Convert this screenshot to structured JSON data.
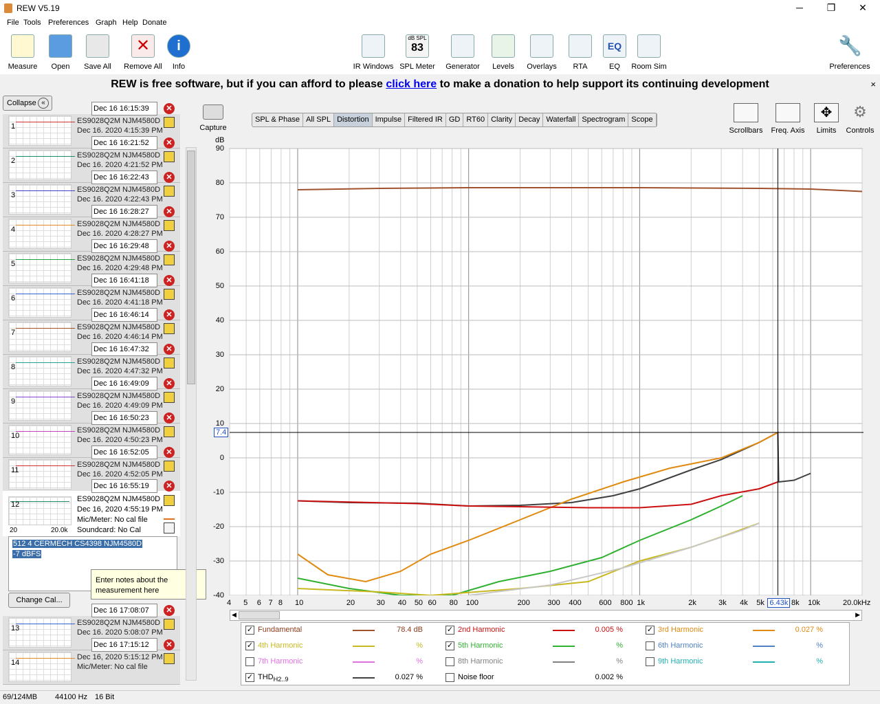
{
  "window": {
    "title": "REW V5.19"
  },
  "menu": [
    "File",
    "Tools",
    "Preferences",
    "Graph",
    "Help",
    "Donate"
  ],
  "toolbar": {
    "left": [
      {
        "label": "Measure",
        "icon": "measure-icon"
      },
      {
        "label": "Open",
        "icon": "folder-open-icon"
      },
      {
        "label": "Save All",
        "icon": "save-all-icon"
      },
      {
        "label": "Remove All",
        "icon": "remove-all-icon"
      },
      {
        "label": "Info",
        "icon": "info-icon"
      }
    ],
    "center": [
      {
        "label": "IR Windows",
        "icon": "ir-windows-icon"
      },
      {
        "label": "SPL Meter",
        "icon": "spl-meter-icon",
        "badge_top": "dB SPL",
        "badge_value": "83"
      },
      {
        "label": "Generator",
        "icon": "generator-icon"
      },
      {
        "label": "Levels",
        "icon": "levels-icon"
      },
      {
        "label": "Overlays",
        "icon": "overlays-icon"
      },
      {
        "label": "RTA",
        "icon": "rta-icon"
      },
      {
        "label": "EQ",
        "icon": "eq-icon"
      },
      {
        "label": "Room Sim",
        "icon": "room-sim-icon"
      }
    ],
    "right": {
      "label": "Preferences",
      "icon": "preferences-icon"
    }
  },
  "donation": {
    "prefix": "REW is free software, but if you can afford to please",
    "link": "click here",
    "suffix": "to make a donation to help support its continuing development",
    "close": "×"
  },
  "left_panel": {
    "collapse_label": "Collapse",
    "measurements": [
      {
        "num": "1",
        "stamp": "Dec 16 16:15:39",
        "name": "ES9028Q2M NJM4580D (",
        "date": "Dec 16, 2020 4:15:39 PM",
        "color": "#d03030"
      },
      {
        "num": "2",
        "stamp": "Dec 16 16:21:52",
        "name": "ES9028Q2M NJM4580D (",
        "date": "Dec 16, 2020 4:21:52 PM",
        "color": "#1a8a6a"
      },
      {
        "num": "3",
        "stamp": "Dec 16 16:22:43",
        "name": "ES9028Q2M NJM4580D (",
        "date": "Dec 16, 2020 4:22:43 PM",
        "color": "#4040d0"
      },
      {
        "num": "4",
        "stamp": "Dec 16 16:28:27",
        "name": "ES9028Q2M NJM4580D (",
        "date": "Dec 16, 2020 4:28:27 PM",
        "color": "#e08a20"
      },
      {
        "num": "5",
        "stamp": "Dec 16 16:29:48",
        "name": "ES9028Q2M NJM4580D (",
        "date": "Dec 16, 2020 4:29:48 PM",
        "color": "#20a040"
      },
      {
        "num": "6",
        "stamp": "Dec 16 16:41:18",
        "name": "ES9028Q2M NJM4580D (",
        "date": "Dec 16, 2020 4:41:18 PM",
        "color": "#3060d0"
      },
      {
        "num": "7",
        "stamp": "Dec 16 16:46:14",
        "name": "ES9028Q2M NJM4580D (",
        "date": "Dec 16, 2020 4:46:14 PM",
        "color": "#a05020"
      },
      {
        "num": "8",
        "stamp": "Dec 16 16:47:32",
        "name": "ES9028Q2M NJM4580D (",
        "date": "Dec 16, 2020 4:47:32 PM",
        "color": "#20a090"
      },
      {
        "num": "9",
        "stamp": "Dec 16 16:49:09",
        "name": "ES9028Q2M NJM4580D (",
        "date": "Dec 16, 2020 4:49:09 PM",
        "color": "#8040d0"
      },
      {
        "num": "10",
        "stamp": "Dec 16 16:50:23",
        "name": "ES9028Q2M NJM4580D (",
        "date": "Dec 16, 2020 4:50:23 PM",
        "color": "#c040c0"
      },
      {
        "num": "11",
        "stamp": "Dec 16 16:52:05",
        "name": "ES9028Q2M NJM4580D (",
        "date": "Dec 16, 2020 4:52:05 PM",
        "color": "#d03030"
      }
    ],
    "expanded": {
      "num": "12",
      "stamp": "Dec 16 16:55:19",
      "name": "ES9028Q2M NJM4580D (",
      "date": "Dec 16, 2020 4:55:19 PM",
      "mic": "Mic/Meter: No cal file",
      "soundcard": "Soundcard: No Cal",
      "thumb_left": "20",
      "thumb_right": "20.0k",
      "notes_line1": "512 4 CERMECH CS4398 NJM4580D",
      "notes_line2": "-7 dBFS",
      "tooltip": "Enter notes about the measurement here",
      "change_cal": "Change Cal..."
    },
    "after": [
      {
        "num": "13",
        "stamp": "Dec 16 17:08:07",
        "name": "ES9028Q2M NJM4580D (",
        "date": "Dec 16, 2020 5:08:07 PM",
        "color": "#3060d0"
      },
      {
        "num": "14",
        "stamp": "Dec 16 17:15:12",
        "name": "Dec 16, 2020 5:15:12 PM",
        "date": "Mic/Meter: No cal file",
        "color": "#e08a20"
      }
    ]
  },
  "capture": {
    "label": "Capture"
  },
  "tabs": [
    "SPL & Phase",
    "All SPL",
    "Distortion",
    "Impulse",
    "Filtered IR",
    "GD",
    "RT60",
    "Clarity",
    "Decay",
    "Waterfall",
    "Spectrogram",
    "Scope"
  ],
  "active_tab": "Distortion",
  "right_tools": [
    {
      "label": "Scrollbars",
      "icon": "scrollbars-icon"
    },
    {
      "label": "Freq. Axis",
      "icon": "freq-axis-icon"
    },
    {
      "label": "Limits",
      "icon": "limits-icon"
    },
    {
      "label": "Controls",
      "icon": "controls-icon"
    }
  ],
  "chart_data": {
    "type": "line",
    "ylabel": "dB",
    "ylim": [
      -40,
      90
    ],
    "yticks": [
      90,
      80,
      70,
      60,
      50,
      40,
      30,
      20,
      10,
      0,
      -10,
      -20,
      -30,
      -40
    ],
    "xscale": "log",
    "xlim": [
      4,
      20000
    ],
    "xticks": [
      {
        "v": 4,
        "l": "4"
      },
      {
        "v": 5,
        "l": "5"
      },
      {
        "v": 6,
        "l": "6"
      },
      {
        "v": 7,
        "l": "7"
      },
      {
        "v": 8,
        "l": "8"
      },
      {
        "v": 10,
        "l": "10"
      },
      {
        "v": 20,
        "l": "20"
      },
      {
        "v": 30,
        "l": "30"
      },
      {
        "v": 40,
        "l": "40"
      },
      {
        "v": 50,
        "l": "50"
      },
      {
        "v": 60,
        "l": "60"
      },
      {
        "v": 80,
        "l": "80"
      },
      {
        "v": 100,
        "l": "100"
      },
      {
        "v": 200,
        "l": "200"
      },
      {
        "v": 300,
        "l": "300"
      },
      {
        "v": 400,
        "l": "400"
      },
      {
        "v": 600,
        "l": "600"
      },
      {
        "v": 800,
        "l": "800"
      },
      {
        "v": 1000,
        "l": "1k"
      },
      {
        "v": 2000,
        "l": "2k"
      },
      {
        "v": 3000,
        "l": "3k"
      },
      {
        "v": 4000,
        "l": "4k"
      },
      {
        "v": 5000,
        "l": "5k"
      },
      {
        "v": 8000,
        "l": "8k"
      },
      {
        "v": 10000,
        "l": "10k"
      },
      {
        "v": 20000,
        "l": "20.0kHz"
      }
    ],
    "cursor": {
      "x": 6430,
      "x_label": "6.43k",
      "y": 7.4,
      "y_label": "7.4"
    },
    "series": [
      {
        "name": "Fundamental",
        "color": "#a0522d",
        "points": [
          [
            10,
            78
          ],
          [
            30,
            78.4
          ],
          [
            100,
            78.6
          ],
          [
            1000,
            78.6
          ],
          [
            5000,
            78.4
          ],
          [
            10000,
            78.2
          ],
          [
            15000,
            77.8
          ],
          [
            20000,
            77.5
          ]
        ]
      },
      {
        "name": "THD",
        "color": "#404040",
        "points": [
          [
            10,
            -12.5
          ],
          [
            20,
            -13
          ],
          [
            50,
            -13.2
          ],
          [
            100,
            -14
          ],
          [
            200,
            -13.8
          ],
          [
            400,
            -13
          ],
          [
            700,
            -11
          ],
          [
            1000,
            -9
          ],
          [
            2000,
            -3.5
          ],
          [
            3000,
            -0.5
          ],
          [
            5000,
            4.5
          ],
          [
            6430,
            7.4
          ],
          [
            6500,
            -7
          ],
          [
            8000,
            -6.5
          ],
          [
            10000,
            -4.5
          ]
        ]
      },
      {
        "name": "3rd Harmonic",
        "color": "#e08a10",
        "points": [
          [
            10,
            -28
          ],
          [
            15,
            -34
          ],
          [
            25,
            -36
          ],
          [
            40,
            -33
          ],
          [
            60,
            -28
          ],
          [
            100,
            -24
          ],
          [
            200,
            -18
          ],
          [
            400,
            -12
          ],
          [
            800,
            -7
          ],
          [
            1500,
            -3
          ],
          [
            3000,
            0
          ],
          [
            5000,
            4.5
          ],
          [
            6430,
            7.4
          ]
        ]
      },
      {
        "name": "2nd Harmonic",
        "color": "#cc1010",
        "points": [
          [
            10,
            -12.5
          ],
          [
            50,
            -13.3
          ],
          [
            100,
            -14
          ],
          [
            200,
            -14.2
          ],
          [
            500,
            -14.5
          ],
          [
            1000,
            -14.5
          ],
          [
            2000,
            -13.5
          ],
          [
            3000,
            -11
          ],
          [
            5000,
            -9
          ],
          [
            6430,
            -7
          ]
        ]
      },
      {
        "name": "5th Harmonic",
        "color": "#30b030",
        "points": [
          [
            10,
            -35
          ],
          [
            20,
            -38
          ],
          [
            40,
            -40
          ],
          [
            80,
            -40
          ],
          [
            150,
            -36
          ],
          [
            300,
            -33
          ],
          [
            600,
            -29
          ],
          [
            1000,
            -24
          ],
          [
            2000,
            -18
          ],
          [
            3000,
            -14
          ],
          [
            4000,
            -11
          ]
        ]
      },
      {
        "name": "4th Harmonic",
        "color": "#c8b820",
        "points": [
          [
            10,
            -38
          ],
          [
            30,
            -39
          ],
          [
            60,
            -40
          ],
          [
            200,
            -38
          ],
          [
            500,
            -36
          ],
          [
            1000,
            -30
          ],
          [
            2000,
            -26
          ],
          [
            3000,
            -23
          ],
          [
            5000,
            -19
          ]
        ]
      },
      {
        "name": "7th Harmonic",
        "color": "#c8c8c8",
        "points": [
          [
            100,
            -40
          ],
          [
            300,
            -37
          ],
          [
            800,
            -32
          ],
          [
            2000,
            -26
          ],
          [
            4000,
            -21
          ],
          [
            5000,
            -19
          ]
        ]
      }
    ]
  },
  "legend": [
    {
      "label": "THD",
      "sub": "H2..9",
      "checked": true,
      "color": "#404040",
      "value": "0.027 %",
      "label_color": "#000"
    },
    {
      "label": "Fundamental",
      "checked": true,
      "color": "#a0522d",
      "value": "78.4 dB",
      "label_color": "#8b3a1a"
    },
    {
      "label": "2nd Harmonic",
      "checked": true,
      "color": "#cc1010",
      "value": "0.005 %",
      "label_color": "#cc1010"
    },
    {
      "label": "3rd Harmonic",
      "checked": true,
      "color": "#e08a10",
      "value": "0.027 %",
      "label_color": "#e08a10"
    },
    {
      "label": "4th Harmonic",
      "checked": true,
      "color": "#c8b820",
      "value": "%",
      "label_color": "#c8b820"
    },
    {
      "label": "5th Harmonic",
      "checked": true,
      "color": "#30b030",
      "value": "%",
      "label_color": "#30b030"
    },
    {
      "label": "6th Harmonic",
      "checked": false,
      "color": "#5080c0",
      "value": "%",
      "label_color": "#5080c0"
    },
    {
      "label": "7th Harmonic",
      "checked": false,
      "color": "#e070e0",
      "value": "%",
      "label_color": "#e070e0"
    },
    {
      "label": "8th Harmonic",
      "checked": false,
      "color": "#808080",
      "value": "%",
      "label_color": "#808080"
    },
    {
      "label": "9th Harmonic",
      "checked": false,
      "color": "#20b0b0",
      "value": "%",
      "label_color": "#20b0b0"
    },
    {
      "label": "Noise floor",
      "checked": false,
      "color": "#000",
      "value": "0.002 %",
      "label_color": "#000"
    }
  ],
  "status": {
    "memory": "69/124MB",
    "rate": "44100 Hz",
    "bits": "16 Bit"
  }
}
